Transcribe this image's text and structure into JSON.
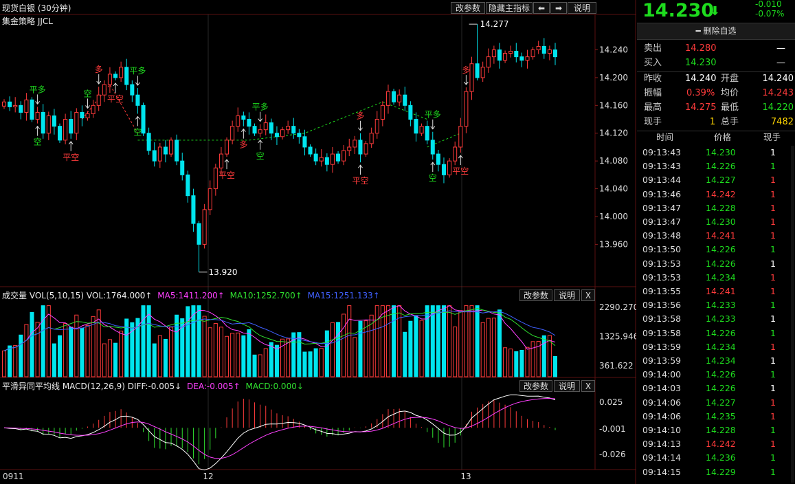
{
  "title": "现货白银 (30分钟)",
  "strategy": "集金策略 JJCL",
  "toolbar": {
    "params": "改参数",
    "hide": "隐藏主指标",
    "left": "⬅",
    "right": "➡",
    "help": "说明"
  },
  "price_axis": [
    "14.240",
    "14.200",
    "14.160",
    "14.120",
    "14.080",
    "14.040",
    "14.000",
    "13.960"
  ],
  "hi_label": "14.277",
  "lo_label": "13.920",
  "signals": [
    {
      "t": "平多",
      "c": "#1edc1e"
    },
    {
      "t": "空",
      "c": "#1edc1e"
    },
    {
      "t": "平空",
      "c": "#ff3b3b"
    },
    {
      "t": "空",
      "c": "#1edc1e"
    },
    {
      "t": "平空",
      "c": "#ff3b3b"
    },
    {
      "t": "多",
      "c": "#ff3b3b"
    },
    {
      "t": "平多",
      "c": "#1edc1e"
    },
    {
      "t": "空",
      "c": "#1edc1e"
    },
    {
      "t": "平空",
      "c": "#ff3b3b"
    },
    {
      "t": "多",
      "c": "#ff3b3b"
    },
    {
      "t": "平多",
      "c": "#1edc1e"
    },
    {
      "t": "空",
      "c": "#1edc1e"
    },
    {
      "t": "多",
      "c": "#ff3b3b"
    },
    {
      "t": "平空",
      "c": "#ff3b3b"
    },
    {
      "t": "平多",
      "c": "#1edc1e"
    },
    {
      "t": "空",
      "c": "#1edc1e"
    },
    {
      "t": "平空",
      "c": "#ff3b3b"
    },
    {
      "t": "多",
      "c": "#ff3b3b"
    }
  ],
  "vol": {
    "title": "成交量 VOL(5,10,15) VOL:1764.000↑",
    "ma5": "MA5:1411.200↑",
    "ma10": "MA10:1252.700↑",
    "ma15": "MA15:1251.133↑",
    "axis": [
      "2290.270",
      "1325.946",
      "361.622"
    ],
    "params": "改参数",
    "help": "说明",
    "close": "X"
  },
  "macd": {
    "title": "平滑异同平均线 MACD(12,26,9) DIFF:-0.005↓",
    "dea": "DEA:-0.005↑",
    "macd": "MACD:0.000↓",
    "axis": [
      "0.025",
      "-0.001",
      "-0.026"
    ],
    "params": "改参数",
    "help": "说明",
    "close": "X"
  },
  "x_axis": [
    "0911",
    "12",
    "13"
  ],
  "quote": {
    "price": "14.230",
    "arrow": "⬇",
    "change": "-0.010",
    "pct": "-0.07%",
    "watch": "━ 删除自选",
    "sell_label": "卖出",
    "sell": "14.280",
    "sell_vol": "—",
    "buy_label": "买入",
    "buy": "14.230",
    "buy_vol": "—",
    "prev_label": "昨收",
    "prev": "14.240",
    "open_label": "开盘",
    "open": "14.240",
    "amp_label": "振幅",
    "amp": "0.39%",
    "avg_label": "均价",
    "avg": "14.243",
    "high_label": "最高",
    "high": "14.275",
    "low_label": "最低",
    "low": "14.220",
    "cur_label": "现手",
    "cur": "1",
    "total_label": "总手",
    "total": "7482"
  },
  "ticks_header": {
    "time": "时间",
    "price": "价格",
    "vol": "现手"
  },
  "ticks": [
    {
      "time": "09:13:43",
      "price": "14.230",
      "pc": "g",
      "vol": "1",
      "vc": "w"
    },
    {
      "time": "09:13:43",
      "price": "14.226",
      "pc": "g",
      "vol": "1",
      "vc": "g"
    },
    {
      "time": "09:13:44",
      "price": "14.227",
      "pc": "g",
      "vol": "1",
      "vc": "r"
    },
    {
      "time": "09:13:46",
      "price": "14.242",
      "pc": "r",
      "vol": "1",
      "vc": "r"
    },
    {
      "time": "09:13:47",
      "price": "14.228",
      "pc": "g",
      "vol": "1",
      "vc": "r"
    },
    {
      "time": "09:13:47",
      "price": "14.230",
      "pc": "g",
      "vol": "1",
      "vc": "r"
    },
    {
      "time": "09:13:48",
      "price": "14.241",
      "pc": "r",
      "vol": "1",
      "vc": "r"
    },
    {
      "time": "09:13:50",
      "price": "14.226",
      "pc": "g",
      "vol": "1",
      "vc": "g"
    },
    {
      "time": "09:13:53",
      "price": "14.226",
      "pc": "g",
      "vol": "1",
      "vc": "w"
    },
    {
      "time": "09:13:53",
      "price": "14.234",
      "pc": "g",
      "vol": "1",
      "vc": "r"
    },
    {
      "time": "09:13:55",
      "price": "14.241",
      "pc": "r",
      "vol": "1",
      "vc": "r"
    },
    {
      "time": "09:13:56",
      "price": "14.233",
      "pc": "g",
      "vol": "1",
      "vc": "g"
    },
    {
      "time": "09:13:58",
      "price": "14.233",
      "pc": "g",
      "vol": "1",
      "vc": "w"
    },
    {
      "time": "09:13:58",
      "price": "14.226",
      "pc": "g",
      "vol": "1",
      "vc": "g"
    },
    {
      "time": "09:13:59",
      "price": "14.234",
      "pc": "g",
      "vol": "1",
      "vc": "r"
    },
    {
      "time": "09:13:59",
      "price": "14.234",
      "pc": "g",
      "vol": "1",
      "vc": "w"
    },
    {
      "time": "09:14:00",
      "price": "14.226",
      "pc": "g",
      "vol": "1",
      "vc": "g"
    },
    {
      "time": "09:14:03",
      "price": "14.226",
      "pc": "g",
      "vol": "1",
      "vc": "w"
    },
    {
      "time": "09:14:06",
      "price": "14.227",
      "pc": "g",
      "vol": "1",
      "vc": "r"
    },
    {
      "time": "09:14:06",
      "price": "14.235",
      "pc": "g",
      "vol": "1",
      "vc": "r"
    },
    {
      "time": "09:14:10",
      "price": "14.228",
      "pc": "g",
      "vol": "1",
      "vc": "g"
    },
    {
      "time": "09:14:13",
      "price": "14.242",
      "pc": "r",
      "vol": "1",
      "vc": "r"
    },
    {
      "time": "09:14:14",
      "price": "14.236",
      "pc": "g",
      "vol": "1",
      "vc": "g"
    },
    {
      "time": "09:14:15",
      "price": "14.229",
      "pc": "g",
      "vol": "1",
      "vc": "g"
    }
  ],
  "chart_data": {
    "type": "candlestick",
    "title": "现货白银 (30分钟)",
    "ylim": [
      13.92,
      14.277
    ],
    "close": [
      14.165,
      14.158,
      14.16,
      14.15,
      14.168,
      14.14,
      14.15,
      14.12,
      14.145,
      14.13,
      14.11,
      14.14,
      14.12,
      14.15,
      14.142,
      14.148,
      14.16,
      14.175,
      14.19,
      14.205,
      14.2,
      14.215,
      14.19,
      14.175,
      14.16,
      14.12,
      14.095,
      14.08,
      14.1,
      14.09,
      14.11,
      14.08,
      14.06,
      14.03,
      13.99,
      13.96,
      14.01,
      14.04,
      14.07,
      14.09,
      14.11,
      14.13,
      14.145,
      14.14,
      14.13,
      14.12,
      14.125,
      14.135,
      14.12,
      14.115,
      14.125,
      14.13,
      14.12,
      14.115,
      14.1,
      14.09,
      14.08,
      14.085,
      14.075,
      14.09,
      14.08,
      14.095,
      14.1,
      14.11,
      14.09,
      14.105,
      14.12,
      14.14,
      14.16,
      14.18,
      14.165,
      14.175,
      14.16,
      14.14,
      14.12,
      14.13,
      14.11,
      14.09,
      14.075,
      14.06,
      14.08,
      14.1,
      14.13,
      14.18,
      14.22,
      14.2,
      14.215,
      14.23,
      14.24,
      14.225,
      14.235,
      14.238,
      14.23,
      14.225,
      14.23,
      14.24,
      14.245,
      14.235,
      14.24,
      14.23
    ],
    "vol_ylim": [
      0,
      2500
    ],
    "macd_ylim": [
      -0.04,
      0.035
    ]
  }
}
